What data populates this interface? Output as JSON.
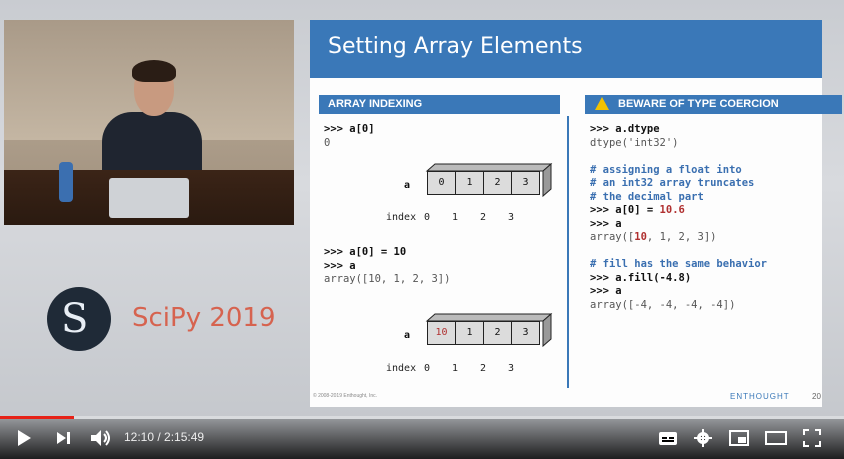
{
  "logo": {
    "text": "SciPy 2019"
  },
  "slide": {
    "title": "Setting Array Elements",
    "left_header": "ARRAY INDEXING",
    "right_header": "BEWARE OF TYPE COERCION",
    "left_code_1": [
      ">>> a[0]",
      "0"
    ],
    "array_label": "a",
    "array1": [
      "0",
      "1",
      "2",
      "3"
    ],
    "index_label": "index",
    "indices": [
      "0",
      "1",
      "2",
      "3"
    ],
    "left_code_2": [
      ">>> a[0] = 10",
      ">>> a",
      "array([10, 1, 2, 3])"
    ],
    "array2": [
      "10",
      "1",
      "2",
      "3"
    ],
    "right_code": [
      ">>> a.dtype",
      "dtype('int32')",
      "",
      "# assigning a float into",
      "# an int32 array truncates",
      "# the decimal part",
      ">>> a[0] = 10.6",
      ">>> a",
      "array([10, 1, 2, 3])",
      "",
      "# fill has the same behavior",
      ">>> a.fill(-4.8)",
      ">>> a",
      "array([-4, -4, -4, -4])"
    ],
    "footer_left": "© 2008-2019 Enthought, Inc.",
    "footer_brand": "ENTHOUGHT",
    "page_number": "20"
  },
  "player": {
    "time": "12:10 / 2:15:49",
    "progress_fraction": 0.088,
    "accent": "#e62117"
  }
}
